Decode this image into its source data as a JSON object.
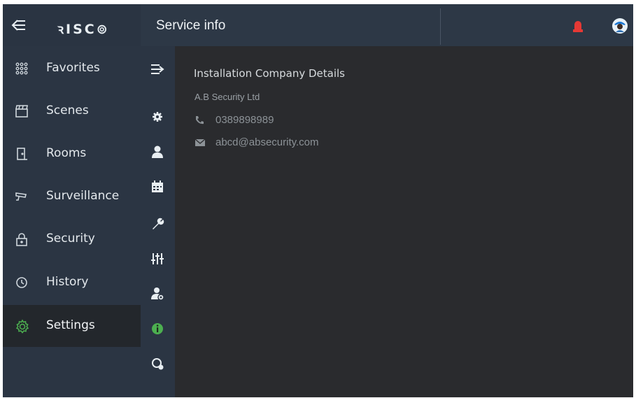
{
  "app": {
    "logo": "ꝛISC⊚",
    "page_title": "Service info"
  },
  "sidebar": {
    "items": [
      {
        "label": "Favorites",
        "icon": "grid-dots-icon"
      },
      {
        "label": "Scenes",
        "icon": "clapperboard-icon"
      },
      {
        "label": "Rooms",
        "icon": "door-icon"
      },
      {
        "label": "Surveillance",
        "icon": "camera-icon"
      },
      {
        "label": "Security",
        "icon": "padlock-icon"
      },
      {
        "label": "History",
        "icon": "history-icon"
      },
      {
        "label": "Settings",
        "icon": "gear-icon",
        "active": true
      }
    ]
  },
  "subnav": {
    "icons": [
      "collapse-menu-icon",
      "gear-icon",
      "user-icon",
      "calendar-icon",
      "wrench-icon",
      "sliders-icon",
      "user-settings-icon",
      "info-icon",
      "diagnostics-icon"
    ],
    "active": "info-icon"
  },
  "service": {
    "section_title": "Installation Company Details",
    "company": "A.B Security Ltd",
    "phone": "0389898989",
    "email": "abcd@absecurity.com"
  },
  "colors": {
    "sidebar_bg": "#2b3543",
    "content_bg": "#2a2b2e",
    "accent_green": "#4caf50",
    "alarm_red": "#e53935"
  }
}
